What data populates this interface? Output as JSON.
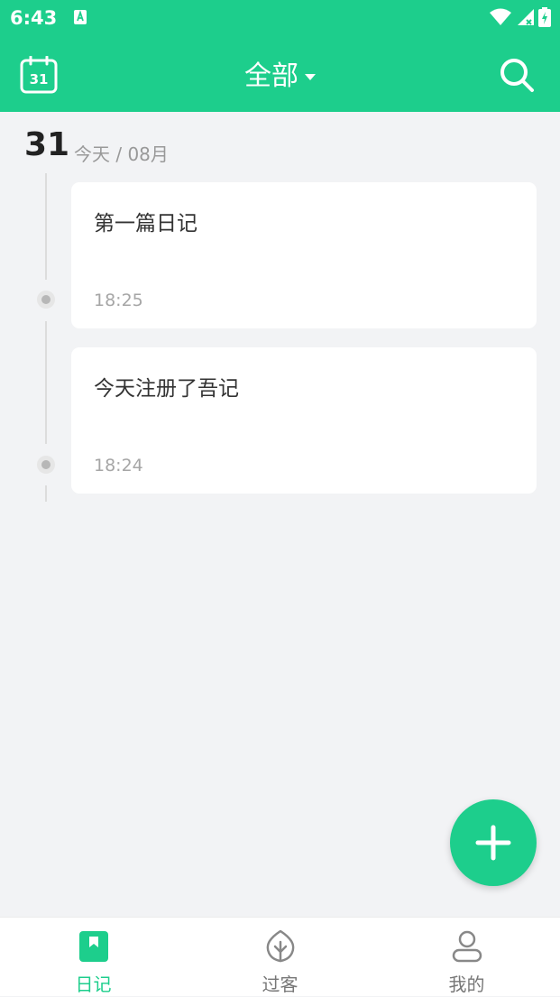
{
  "status_bar": {
    "time": "6:43"
  },
  "header": {
    "filter_label": "全部"
  },
  "day_group": {
    "day": "31",
    "subtitle": "今天 / 08月"
  },
  "entries": [
    {
      "title": "第一篇日记",
      "time": "18:25"
    },
    {
      "title": "今天注册了吾记",
      "time": "18:24"
    }
  ],
  "bottom_nav": {
    "tabs": [
      {
        "label": "日记",
        "icon": "bookmark-icon",
        "active": true
      },
      {
        "label": "过客",
        "icon": "leaf-icon",
        "active": false
      },
      {
        "label": "我的",
        "icon": "user-icon",
        "active": false
      }
    ]
  },
  "colors": {
    "accent": "#1dce8c",
    "background": "#f2f3f5",
    "card": "#ffffff"
  },
  "icons": {
    "calendar": "calendar-icon",
    "search": "search-icon",
    "add": "plus-icon"
  },
  "calendar_icon_day": "31"
}
